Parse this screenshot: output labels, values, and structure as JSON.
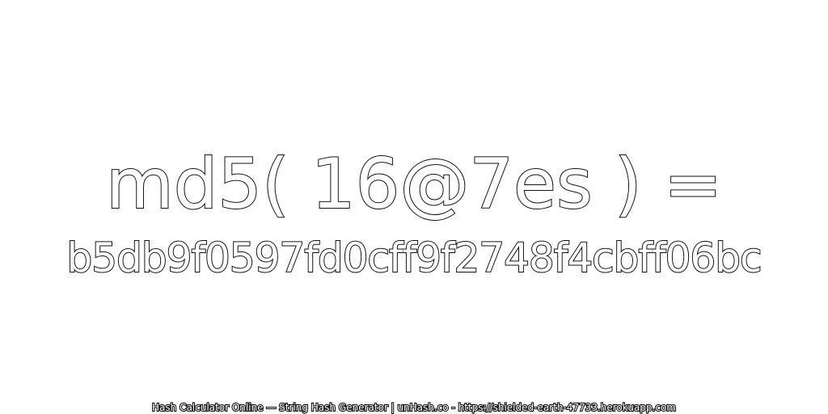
{
  "expression": "md5( 16@7es ) =",
  "hash": "b5db9f0597fd0cff9f2748f4cbff06bc",
  "footer": "Hash Calculator Online — String Hash Generator | unHash.co - https://shielded-earth-47733.herokuapp.com",
  "colors": {
    "background": "#ffffff",
    "text_fill": "#ffffff",
    "text_outline": "#111111"
  }
}
